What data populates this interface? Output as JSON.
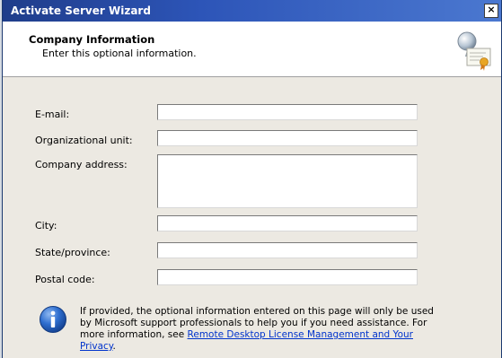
{
  "window": {
    "title": "Activate Server Wizard",
    "close_glyph": "×"
  },
  "header": {
    "title": "Company Information",
    "subtitle": "Enter this optional information.",
    "icon": "certificate-icon"
  },
  "form": {
    "email": {
      "label": "E-mail:",
      "value": ""
    },
    "org_unit": {
      "label": "Organizational unit:",
      "value": ""
    },
    "company_address": {
      "label": "Company address:",
      "value": ""
    },
    "city": {
      "label": "City:",
      "value": ""
    },
    "state": {
      "label": "State/province:",
      "value": ""
    },
    "postal_code": {
      "label": "Postal code:",
      "value": ""
    }
  },
  "info": {
    "icon": "info-icon",
    "text_before_link": "If provided, the optional information entered on this page will only be used by Microsoft support professionals to help you if you need assistance. For more information, see ",
    "link_text": "Remote Desktop License Management and Your Privacy",
    "text_after_link": "."
  },
  "colors": {
    "titlebar": "#2d55b8",
    "dialog_bg": "#ece9e2",
    "link": "#0033cc"
  }
}
